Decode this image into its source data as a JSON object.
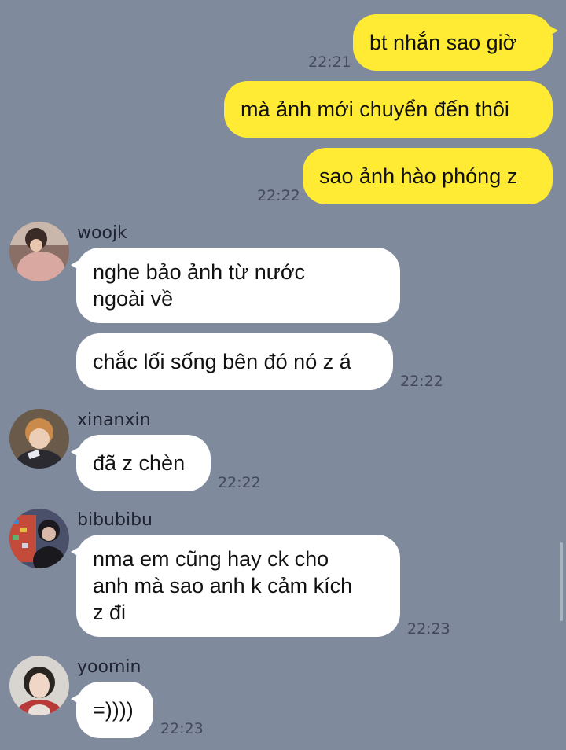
{
  "sent": [
    {
      "text": "bt nhắn sao giờ",
      "time": "22:21"
    },
    {
      "text": "mà ảnh mới chuyển đến thôi"
    },
    {
      "text": "sao ảnh hào phóng z",
      "time": "22:22"
    }
  ],
  "groups": [
    {
      "name": "woojk",
      "messages": [
        "nghe bảo ảnh từ nước",
        "ngoài về",
        "chắc lối sống bên đó nó z á"
      ],
      "time": "22:22"
    },
    {
      "name": "xinanxin",
      "messages": [
        "đã z chèn"
      ],
      "time": "22:22"
    },
    {
      "name": "bibubibu",
      "messages": [
        "nma em cũng hay ck cho",
        "anh mà sao anh k cảm kích",
        "z đi"
      ],
      "time": "22:23"
    },
    {
      "name": "yoomin",
      "messages": [
        "=))))"
      ],
      "time": "22:23"
    }
  ],
  "colors": {
    "background": "#7f8a9d",
    "sent_bubble": "#ffeb34",
    "received_bubble": "#ffffff"
  },
  "icons": [
    "avatar-woojk",
    "avatar-xinanxin",
    "avatar-bibubibu",
    "avatar-yoomin"
  ]
}
